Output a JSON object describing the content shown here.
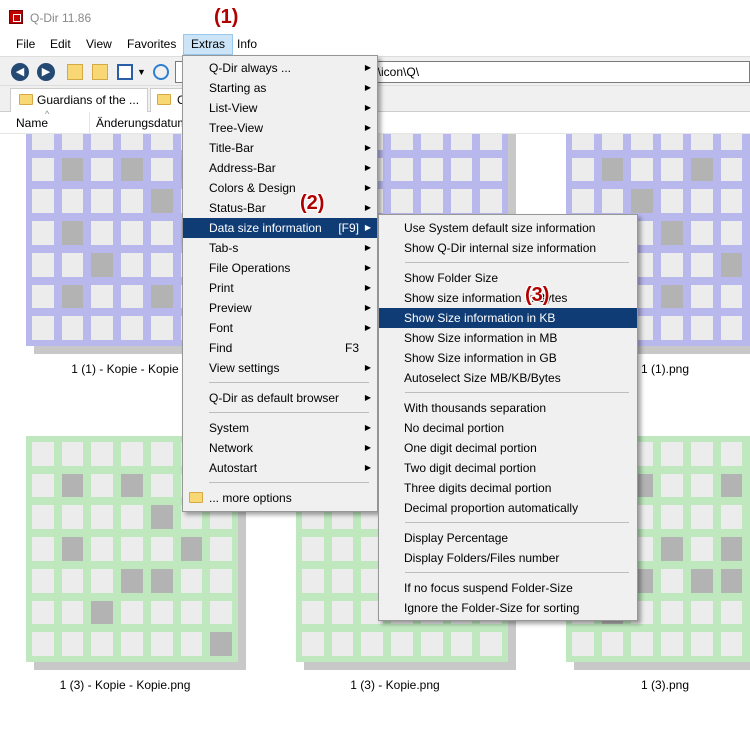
{
  "window": {
    "title": "Q-Dir 11.86"
  },
  "menubar": [
    "File",
    "Edit",
    "View",
    "Favorites",
    "Extras",
    "Info"
  ],
  "address": {
    "path": "g\\icon\\Q\\"
  },
  "tabs": [
    "Guardians of the ...",
    "C"
  ],
  "columns": {
    "name": "Name",
    "date": "Änderungsdatum"
  },
  "annotations": {
    "a1": "(1)",
    "a2": "(2)",
    "a3": "(3)"
  },
  "thumbnails": {
    "r1": [
      "1 (1) - Kopie - Kopie",
      "",
      "1 (1).png"
    ],
    "r2": [
      "1 (3) - Kopie - Kopie.png",
      "1 (3) - Kopie.png",
      "1 (3).png"
    ]
  },
  "extras_menu": {
    "items": [
      "Q-Dir always ...",
      "Starting as",
      "List-View",
      "Tree-View",
      "Title-Bar",
      "Address-Bar",
      "Colors & Design",
      "Status-Bar",
      "Data size information",
      "Tab-s",
      "File Operations",
      "Print",
      "Preview",
      "Font",
      "Find",
      "View settings",
      "Q-Dir as default browser",
      "System",
      "Network",
      "Autostart",
      "... more options"
    ],
    "shortcuts": {
      "data_size": "[F9]",
      "find": "F3"
    }
  },
  "size_menu": {
    "items": [
      "Use System default size information",
      "Show Q-Dir internal size information",
      "Show Folder Size",
      "Show size information in Bytes",
      "Show Size information in KB",
      "Show Size information in MB",
      "Show Size information in GB",
      "Autoselect Size MB/KB/Bytes",
      "With thousands separation",
      "No decimal portion",
      "One digit decimal portion",
      "Two digit decimal portion",
      "Three digits decimal portion",
      "Decimal proportion automatically",
      "Display Percentage",
      "Display Folders/Files number",
      "If no focus suspend Folder-Size",
      "Ignore the Folder-Size for sorting"
    ]
  },
  "colors": {
    "highlight": "#103c75",
    "annotation": "#b00000",
    "blue_grid": "#b8b8ec",
    "green_grid": "#bfe8bf"
  },
  "icons": [
    "back-icon",
    "forward-icon",
    "up-folder-icon",
    "new-folder-icon",
    "view-mode-icon",
    "refresh-icon",
    "sort-arrow-icon",
    "submenu-arrow-icon",
    "folder-icon"
  ]
}
